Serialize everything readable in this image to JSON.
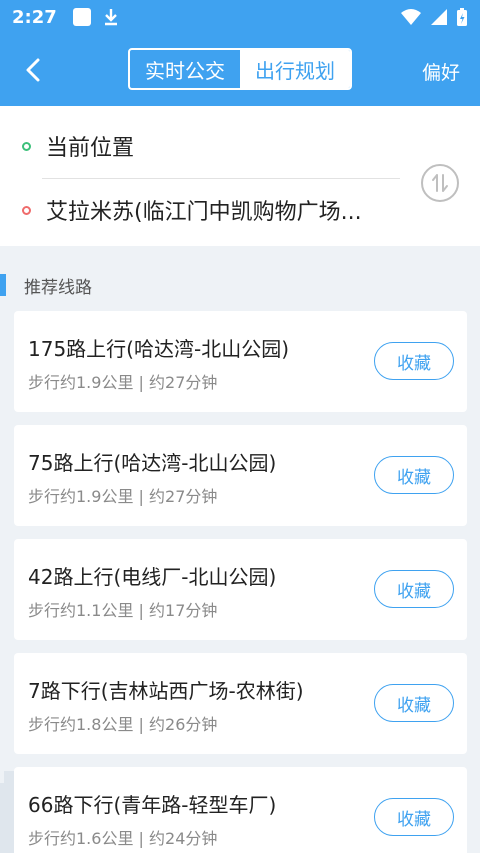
{
  "status_bar": {
    "time": "2:27"
  },
  "header": {
    "segments": [
      {
        "label": "实时公交",
        "active": false
      },
      {
        "label": "出行规划",
        "active": true
      }
    ],
    "preference_label": "偏好"
  },
  "route": {
    "start": "当前位置",
    "end": "艾拉米苏(临江门中凯购物广场..."
  },
  "section_title": "推荐线路",
  "routes": [
    {
      "name": "175路上行(哈达湾-北山公园)",
      "meta": "步行约1.9公里 | 约27分钟",
      "action": "收藏"
    },
    {
      "name": "75路上行(哈达湾-北山公园)",
      "meta": "步行约1.9公里 | 约27分钟",
      "action": "收藏"
    },
    {
      "name": "42路上行(电线厂-北山公园)",
      "meta": "步行约1.1公里 | 约17分钟",
      "action": "收藏"
    },
    {
      "name": "7路下行(吉林站西广场-农林街)",
      "meta": "步行约1.8公里 | 约26分钟",
      "action": "收藏"
    },
    {
      "name": "66路下行(青年路-轻型车厂)",
      "meta": "步行约1.6公里 | 约24分钟",
      "action": "收藏"
    }
  ],
  "colors": {
    "primary": "#3fa2f0",
    "start_dot": "#3cc07a",
    "end_dot": "#ef6b6b"
  }
}
